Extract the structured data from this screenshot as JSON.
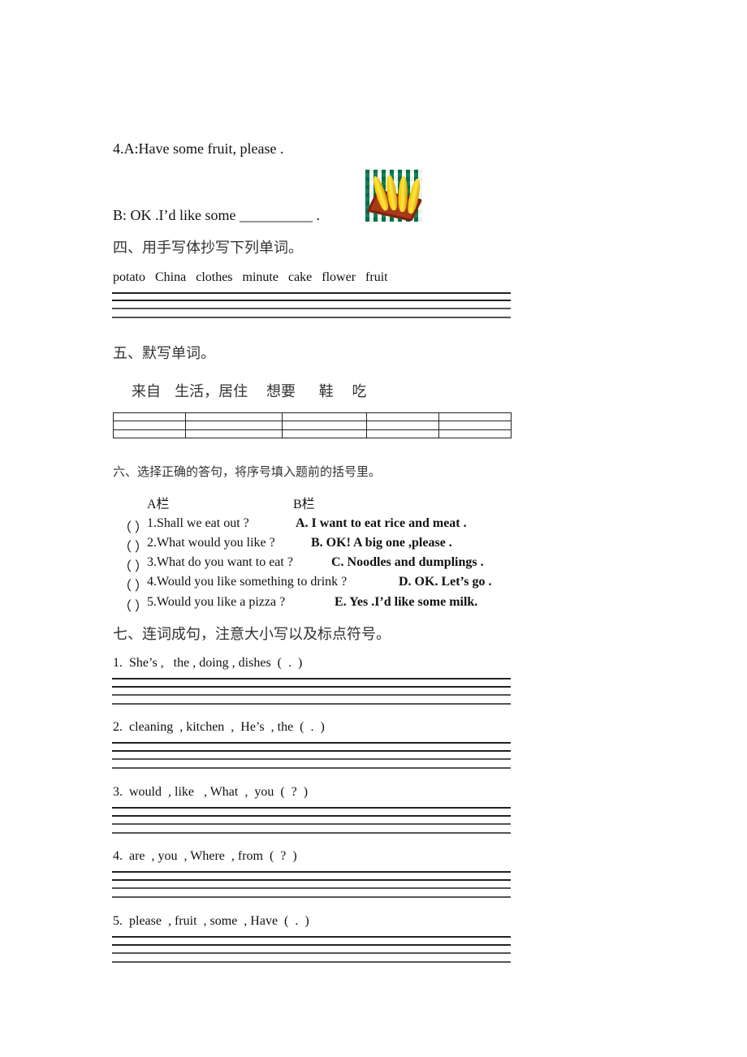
{
  "q4_dialogue": {
    "line_a": "4.A:Have some fruit, please .",
    "line_b": "B: OK .I’d like some __________ .",
    "image_icon": "bananas-picture"
  },
  "section4": {
    "title": "四、用手写体抄写下列单词。",
    "words": "potato   China   clothes   minute   cake   flower   fruit"
  },
  "section5": {
    "title": "五、默写单词。",
    "words": "来自   生活，居住    想要     鞋    吃",
    "table_rows": 3,
    "table_cols": 5
  },
  "section6": {
    "title": "六、选择正确的答句，将序号填入题前的括号里。",
    "col_a_header": "A栏",
    "col_b_header": "B栏",
    "items": [
      {
        "bracket": "（ ）",
        "question": "1.Shall we eat out ?",
        "answer": "A. I want to eat rice and meat ."
      },
      {
        "bracket": "（ ）",
        "question": "2.What would you like ?",
        "answer": "B. OK! A big one ,please ."
      },
      {
        "bracket": "（ ）",
        "question": "3.What do you want to eat ?",
        "answer": "C. Noodles and dumplings ."
      },
      {
        "bracket": "（ ）",
        "question": "4.Would you like something to drink ?",
        "answer": "D. OK. Let’s go ."
      },
      {
        "bracket": "（ ）",
        "question": "5.Would you like a pizza ?",
        "answer": "E. Yes .I’d like some milk."
      }
    ]
  },
  "section7": {
    "title": "七、连词成句，注意大小写以及标点符号。",
    "items": [
      "1.  She’s ,   the , doing , dishes  (  .  )",
      "2.  cleaning  , kitchen  ,  He’s  , the  (  .  )",
      "3.  would  , like   , What  ,  you  (  ?  )",
      "4.  are  , you  , Where  , from  (  ?  )",
      "5.  please  , fruit  , some  , Have  (  .  )"
    ]
  }
}
